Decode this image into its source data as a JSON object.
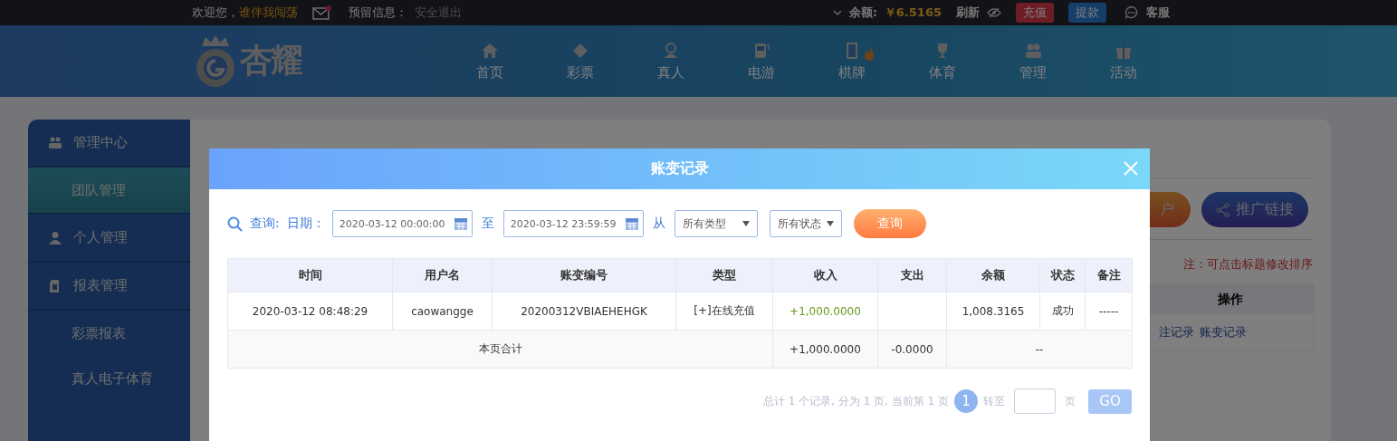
{
  "top_bar": {
    "greeting": "欢迎您，",
    "username": "谁伴我闯荡",
    "has_unread_mail": true,
    "reserved_info_label": "预留信息：",
    "logout": "安全退出",
    "balance_label": "余额:",
    "balance": "￥6.5165",
    "refresh": "刷新",
    "deposit": "充值",
    "withdraw": "提款",
    "support": "客服"
  },
  "nav": {
    "logo": "杏耀",
    "items": [
      {
        "label": "首页",
        "hot": false
      },
      {
        "label": "彩票",
        "hot": false
      },
      {
        "label": "真人",
        "hot": false
      },
      {
        "label": "电游",
        "hot": false
      },
      {
        "label": "棋牌",
        "hot": true
      },
      {
        "label": "体育",
        "hot": false
      },
      {
        "label": "管理",
        "hot": false
      },
      {
        "label": "活动",
        "hot": false
      }
    ]
  },
  "sidebar": {
    "items": [
      {
        "kind": "group",
        "label": "管理中心",
        "selected": false
      },
      {
        "kind": "sub",
        "label": "团队管理",
        "selected": true
      },
      {
        "kind": "group",
        "label": "个人管理",
        "selected": false
      },
      {
        "kind": "group",
        "label": "报表管理",
        "selected": false
      },
      {
        "kind": "sub",
        "label": "彩票报表",
        "selected": false
      },
      {
        "kind": "sub",
        "label": "真人电子体育",
        "selected": false
      }
    ]
  },
  "page": {
    "buttons": [
      "户",
      "推广链接"
    ],
    "note": "注：可点击标题修改排序",
    "table": {
      "columns": [
        "操作"
      ],
      "links": [
        "注记录",
        "账变记录"
      ]
    }
  },
  "modal": {
    "title": "账变记录",
    "filters": {
      "query_label": "查询:",
      "date_label": "日期：",
      "date_from": "2020-03-12 00:00:00",
      "to_label": "至",
      "date_to": "2020-03-12 23:59:59",
      "from_label": "从",
      "type_select": "所有类型",
      "status_select": "所有状态",
      "search_button": "查询"
    },
    "table": {
      "columns": [
        "时间",
        "用户名",
        "账变编号",
        "类型",
        "收入",
        "支出",
        "余额",
        "状态",
        "备注"
      ],
      "rows": [
        [
          "2020-03-12 08:48:29",
          "caowangge",
          "20200312VBIAEHEHGK",
          "[+]在线充值",
          "+1,000.0000",
          "",
          "1,008.3165",
          "成功",
          "-----"
        ]
      ],
      "total": {
        "label": "本页合计",
        "income": "+1,000.0000",
        "expense": "-0.0000",
        "rest": "--"
      }
    },
    "pagination": {
      "summary": "总计 1 个记录, 分为 1 页, 当前第 1 页",
      "current_page": "1",
      "goto_label": "转至",
      "page_label": "页",
      "go_button": "GO"
    }
  }
}
